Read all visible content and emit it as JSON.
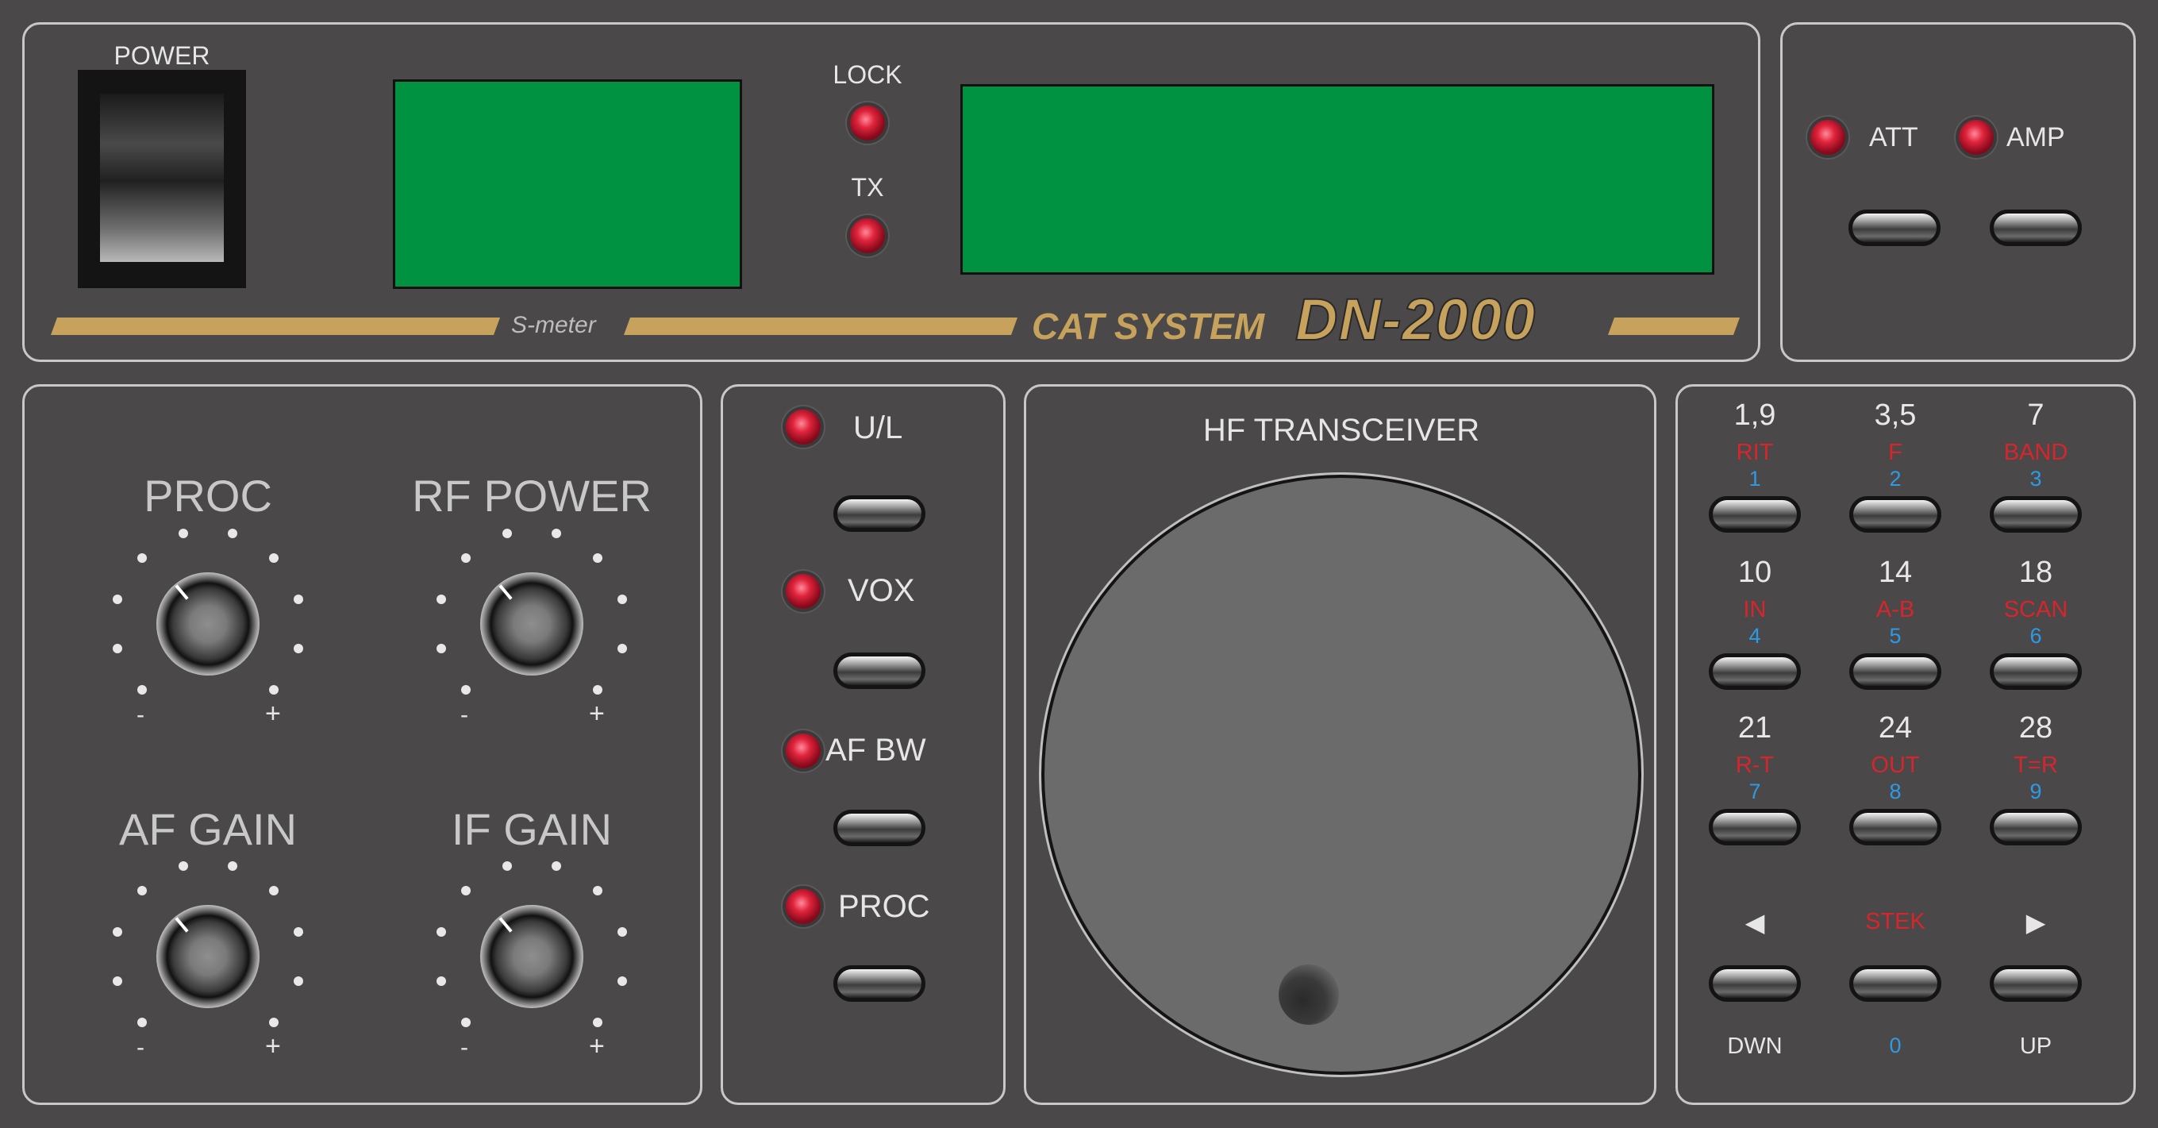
{
  "top": {
    "power_label": "POWER",
    "lock_label": "LOCK",
    "tx_label": "TX",
    "smeter_label": "S-meter",
    "brand_cat": "CAT SYSTEM",
    "brand_model": "DN-2000"
  },
  "right_top": {
    "att_label": "ATT",
    "amp_label": "AMP"
  },
  "knobs": {
    "proc": "PROC",
    "rf_power": "RF POWER",
    "af_gain": "AF GAIN",
    "if_gain": "IF GAIN",
    "minus": "-",
    "plus": "+"
  },
  "mid": {
    "ul": "U/L",
    "vox": "VOX",
    "af_bw": "AF BW",
    "proc": "PROC"
  },
  "dial": {
    "title": "HF TRANSCEIVER"
  },
  "keypad": {
    "keys": [
      {
        "band": "1,9",
        "func": "RIT",
        "digit": "1"
      },
      {
        "band": "3,5",
        "func": "F",
        "digit": "2"
      },
      {
        "band": "7",
        "func": "BAND",
        "digit": "3"
      },
      {
        "band": "10",
        "func": "IN",
        "digit": "4"
      },
      {
        "band": "14",
        "func": "A-B",
        "digit": "5"
      },
      {
        "band": "18",
        "func": "SCAN",
        "digit": "6"
      },
      {
        "band": "21",
        "func": "R-T",
        "digit": "7"
      },
      {
        "band": "24",
        "func": "OUT",
        "digit": "8"
      },
      {
        "band": "28",
        "func": "T=R",
        "digit": "9"
      }
    ],
    "left_arrow": "◀",
    "stek": "STEK",
    "right_arrow": "▶",
    "dwn": "DWN",
    "zero": "0",
    "up": "UP"
  },
  "colors": {
    "panel_bg": "#4a4848",
    "lcd": "#009240",
    "gold": "#c7a25c",
    "led_red": "#e0243c",
    "key_red": "#d8252b",
    "key_blue": "#2e9ae6"
  }
}
